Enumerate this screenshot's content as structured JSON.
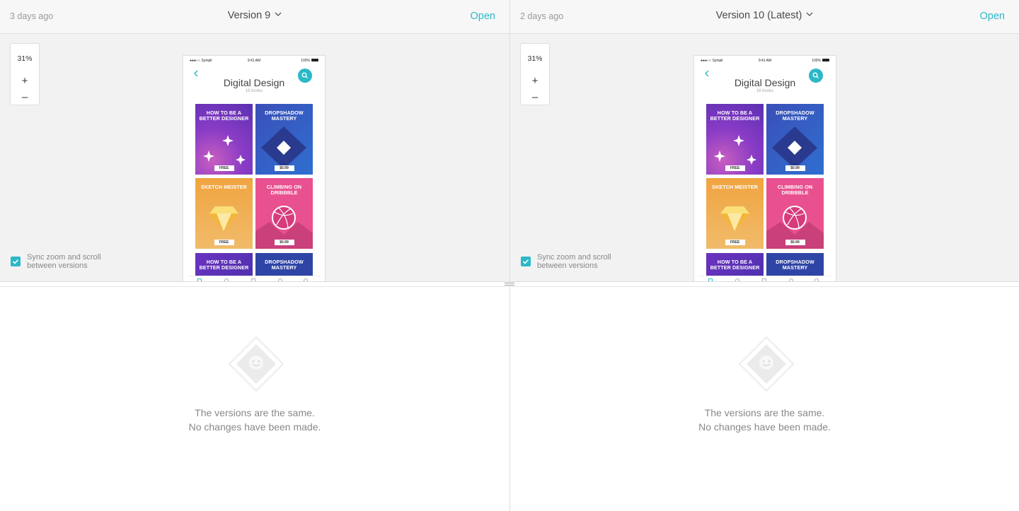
{
  "colors": {
    "accent": "#2bb8c8",
    "pane_bg": "#f2f2f2",
    "header_bg": "#f7f7f7"
  },
  "panes": [
    {
      "ago": "3 days ago",
      "version": "Version 9",
      "open_label": "Open",
      "zoom": "31%",
      "zoom_in": "+",
      "zoom_out": "–",
      "sync_label_line1": "Sync zoom and scroll",
      "sync_label_line2": "between versions",
      "sync_checked": true
    },
    {
      "ago": "2 days ago",
      "version": "Version 10 (Latest)",
      "open_label": "Open",
      "zoom": "31%",
      "zoom_in": "+",
      "zoom_out": "–",
      "sync_label_line1": "Sync zoom and scroll",
      "sync_label_line2": "between versions",
      "sync_checked": true
    }
  ],
  "phone": {
    "carrier": "●●●○○ Sympli",
    "time": "9:41 AM",
    "battery": "100%",
    "title": "Digital Design",
    "subtitle": "16 books",
    "books": [
      {
        "title": "HOW TO BE A BETTER DESIGNER",
        "price": "FREE",
        "icon": "sparkle-icon"
      },
      {
        "title": "DROPSHADOW MASTERY",
        "price": "$0.99",
        "icon": "diamond-shape-icon"
      },
      {
        "title": "SKETCH MEISTER",
        "price": "FREE",
        "icon": "sketch-gem-icon"
      },
      {
        "title": "CLIMBING ON DRIBBBLE",
        "price": "$0.99",
        "icon": "dribbble-ball-icon"
      },
      {
        "title": "HOW TO BE A BETTER DESIGNER",
        "price": "",
        "icon": ""
      },
      {
        "title": "DROPSHADOW MASTERY",
        "price": "",
        "icon": ""
      }
    ]
  },
  "empty_state": {
    "line1": "The versions are the same.",
    "line2": "No changes have been made.",
    "icon": "smiley-diamond-icon"
  }
}
